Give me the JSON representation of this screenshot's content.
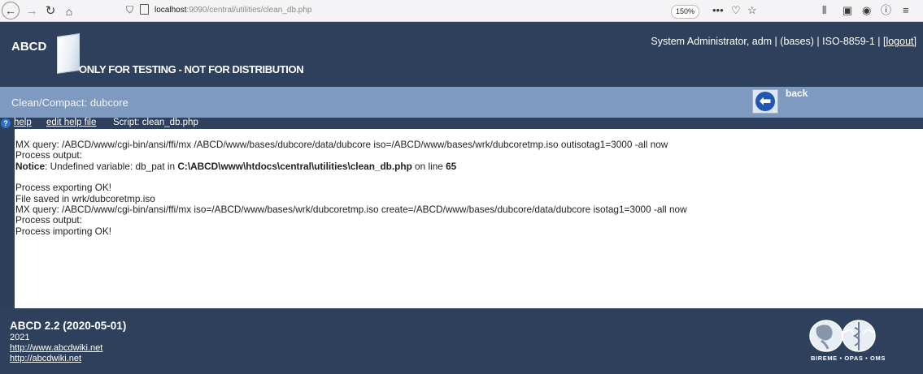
{
  "browser": {
    "url_host": "localhost",
    "url_path": ":9090/central/utilities/clean_db.php",
    "zoom": "150%"
  },
  "header": {
    "logo": "ABCD",
    "banner": "ONLY FOR TESTING - NOT FOR DISTRIBUTION",
    "user_info": "System Administrator, adm | (bases) | ISO-8859-1 |",
    "logout": "[logout]"
  },
  "section": {
    "title": "Clean/Compact: dubcore",
    "back_label": "back"
  },
  "help_bar": {
    "help": "help",
    "edit_help": "edit help file",
    "script": "Script: clean_db.php"
  },
  "output": {
    "line1": "MX query: /ABCD/www/cgi-bin/ansi/ffi/mx /ABCD/www/bases/dubcore/data/dubcore iso=/ABCD/www/bases/wrk/dubcoretmp.iso outisotag1=3000 -all now",
    "line2": "Process output:",
    "notice_label": "Notice",
    "notice_pre": ": Undefined variable: db_pat in ",
    "notice_path": "C:\\ABCD\\www\\htdocs\\central\\utilities\\clean_db.php",
    "notice_mid": " on line ",
    "notice_line": "65",
    "line4": "Process exporting OK!",
    "line5": "File saved in wrk/dubcoretmp.iso",
    "line6": "MX query: /ABCD/www/cgi-bin/ansi/ffi/mx iso=/ABCD/www/bases/wrk/dubcoretmp.iso create=/ABCD/www/bases/dubcore/data/dubcore isotag1=3000 -all now",
    "line7": "Process output:",
    "line8": "Process importing OK!"
  },
  "footer": {
    "version": "ABCD 2.2  (2020-05-01)",
    "year": "2021",
    "link1": "http://www.abcdwiki.net",
    "link2": "http://abcdwiki.net",
    "partner_text": "BIREME • OPAS • OMS"
  },
  "icons": {
    "back": "back-arrow-icon",
    "forward": "forward-arrow-icon",
    "reload": "reload-icon",
    "home": "home-icon",
    "help": "help-icon",
    "go_back": "back-circle-icon"
  }
}
